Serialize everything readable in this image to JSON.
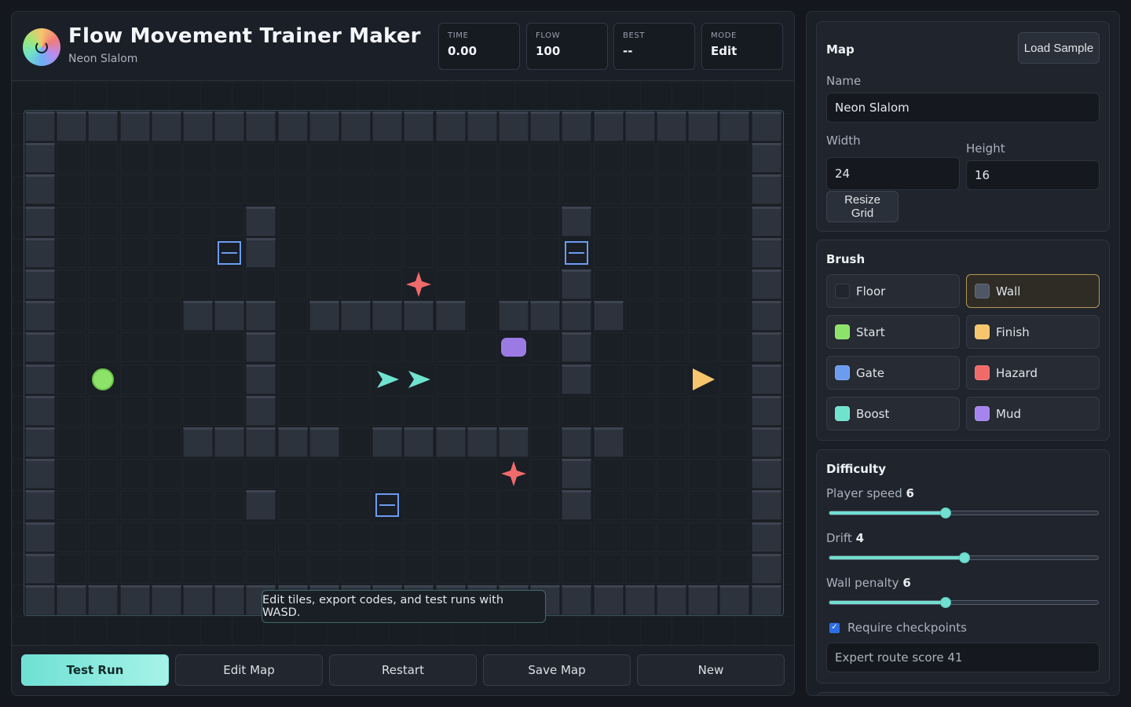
{
  "app": {
    "title": "Flow Movement Trainer Maker",
    "map_subtitle": "Neon Slalom"
  },
  "stats": [
    {
      "label": "TIME",
      "value": "0.00"
    },
    {
      "label": "FLOW",
      "value": "100"
    },
    {
      "label": "BEST",
      "value": "--"
    },
    {
      "label": "MODE",
      "value": "Edit"
    }
  ],
  "board": {
    "cols": 24,
    "rows": 16,
    "walls": [
      [
        7,
        3
      ],
      [
        17,
        3
      ],
      [
        7,
        4
      ],
      [
        17,
        5
      ],
      [
        5,
        6
      ],
      [
        6,
        6
      ],
      [
        7,
        6
      ],
      [
        9,
        6
      ],
      [
        10,
        6
      ],
      [
        11,
        6
      ],
      [
        12,
        6
      ],
      [
        13,
        6
      ],
      [
        15,
        6
      ],
      [
        16,
        6
      ],
      [
        17,
        6
      ],
      [
        18,
        6
      ],
      [
        7,
        7
      ],
      [
        17,
        7
      ],
      [
        7,
        8
      ],
      [
        17,
        8
      ],
      [
        7,
        9
      ],
      [
        5,
        10
      ],
      [
        6,
        10
      ],
      [
        7,
        10
      ],
      [
        8,
        10
      ],
      [
        9,
        10
      ],
      [
        11,
        10
      ],
      [
        12,
        10
      ],
      [
        13,
        10
      ],
      [
        14,
        10
      ],
      [
        15,
        10
      ],
      [
        17,
        10
      ],
      [
        18,
        10
      ],
      [
        17,
        11
      ],
      [
        7,
        12
      ],
      [
        17,
        12
      ]
    ],
    "special": [
      {
        "type": "gate",
        "col": 6,
        "row": 4
      },
      {
        "type": "gate",
        "col": 17,
        "row": 4
      },
      {
        "type": "gate",
        "col": 11,
        "row": 12
      },
      {
        "type": "hazard",
        "col": 12,
        "row": 5
      },
      {
        "type": "hazard",
        "col": 15,
        "row": 11
      },
      {
        "type": "mud",
        "col": 15,
        "row": 7
      },
      {
        "type": "start",
        "col": 2,
        "row": 8
      },
      {
        "type": "boost",
        "col": 11,
        "row": 8
      },
      {
        "type": "boost",
        "col": 12,
        "row": 8
      },
      {
        "type": "finish",
        "col": 21,
        "row": 8
      }
    ],
    "tooltip": "Edit tiles, export codes, and test runs with WASD."
  },
  "actions": {
    "test_run": "Test Run",
    "edit_map": "Edit Map",
    "restart": "Restart",
    "save_map": "Save Map",
    "new": "New"
  },
  "map_section": {
    "title": "Map",
    "load_sample": "Load Sample",
    "name_label": "Name",
    "name_value": "Neon Slalom",
    "width_label": "Width",
    "width_value": "24",
    "height_label": "Height",
    "height_value": "16",
    "resize_button": "Resize Grid"
  },
  "brush_section": {
    "title": "Brush",
    "items": [
      {
        "label": "Floor",
        "color": "#20252e",
        "active": false
      },
      {
        "label": "Wall",
        "color": "#4f5665",
        "active": true
      },
      {
        "label": "Start",
        "color": "#8de36a",
        "active": false
      },
      {
        "label": "Finish",
        "color": "#f6c56c",
        "active": false
      },
      {
        "label": "Gate",
        "color": "#6b9cf0",
        "active": false
      },
      {
        "label": "Hazard",
        "color": "#f06a6a",
        "active": false
      },
      {
        "label": "Boost",
        "color": "#70e3cf",
        "active": false
      },
      {
        "label": "Mud",
        "color": "#a684ee",
        "active": false
      }
    ]
  },
  "difficulty": {
    "title": "Difficulty",
    "player_speed_label": "Player speed",
    "player_speed_value": "6",
    "player_speed_fraction": 0.43,
    "drift_label": "Drift",
    "drift_value": "4",
    "drift_fraction": 0.5,
    "wall_penalty_label": "Wall penalty",
    "wall_penalty_value": "6",
    "wall_penalty_fraction": 0.43,
    "checkpoints_label": "Require checkpoints",
    "checkpoints_checked": true,
    "expert_route": "Expert route score 41"
  },
  "colors": {
    "accent": "#71dfd1",
    "wall": "#2d333d",
    "gate": "#6b9cf0",
    "hazard": "#f06a6a",
    "boost": "#70e3cf",
    "mud": "#9b7be3",
    "start": "#8de36a",
    "finish": "#f6c56c"
  }
}
